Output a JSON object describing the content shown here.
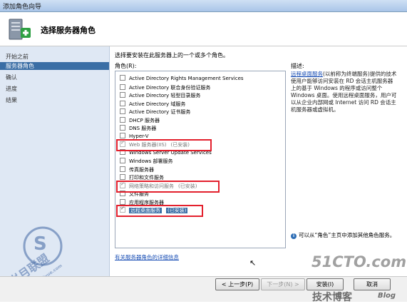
{
  "window": {
    "title": "添加角色向导"
  },
  "header": {
    "title": "选择服务器角色"
  },
  "sidebar": {
    "items": [
      {
        "label": "开始之前",
        "active": false
      },
      {
        "label": "服务器角色",
        "active": true
      },
      {
        "label": "确认",
        "active": false
      },
      {
        "label": "进度",
        "active": false
      },
      {
        "label": "结果",
        "active": false
      }
    ]
  },
  "main": {
    "instruction": "选择要安装在此服务器上的一个或多个角色。",
    "roles_label": "角色(R):",
    "roles": [
      {
        "label": "Active Directory Rights Management Services",
        "installed": false,
        "suffix": ""
      },
      {
        "label": "Active Directory 联合身份验证服务",
        "installed": false,
        "suffix": ""
      },
      {
        "label": "Active Directory 轻型目录服务",
        "installed": false,
        "suffix": ""
      },
      {
        "label": "Active Directory 域服务",
        "installed": false,
        "suffix": ""
      },
      {
        "label": "Active Directory 证书服务",
        "installed": false,
        "suffix": ""
      },
      {
        "label": "DHCP 服务器",
        "installed": false,
        "suffix": ""
      },
      {
        "label": "DNS 服务器",
        "installed": false,
        "suffix": ""
      },
      {
        "label": "Hyper-V",
        "installed": false,
        "suffix": ""
      },
      {
        "label": "Web 服务器(IIS)",
        "installed": true,
        "suffix": "(已安装)"
      },
      {
        "label": "Windows Server Update Services",
        "installed": false,
        "suffix": ""
      },
      {
        "label": "Windows 部署服务",
        "installed": false,
        "suffix": ""
      },
      {
        "label": "传真服务器",
        "installed": false,
        "suffix": ""
      },
      {
        "label": "打印和文件服务",
        "installed": false,
        "suffix": ""
      },
      {
        "label": "网络策略和访问服务",
        "installed": true,
        "suffix": "(已安装)"
      },
      {
        "label": "文件服务",
        "installed": false,
        "suffix": ""
      },
      {
        "label": "应用程序服务器",
        "installed": false,
        "suffix": ""
      },
      {
        "label": "远程桌面服务",
        "installed": true,
        "suffix": "(已安装)",
        "selected": true
      }
    ],
    "description_label": "描述:",
    "description_link": "远程桌面服务",
    "description_text": "(以前称为终端服务)提供的技术使用户能够访问安装在 RD 会话主机服务器上的基于 Windows 的程序或访问整个 Windows 桌面。使用远程桌面服务，用户可以从企业内部网或 Internet 访问 RD 会话主机服务器或虚拟机。",
    "info_note": "可以从“角色”主页中添加其他角色服务。",
    "more_info_link": "有关服务器角色的详细信息"
  },
  "buttons": {
    "prev": "< 上一步(P)",
    "next": "下一步(N) >",
    "install": "安装(I)",
    "cancel": "取消"
  },
  "watermarks": {
    "site": "51CTO.com",
    "tag": "技术博客",
    "blog": "Blog",
    "left_big": "S",
    "left_text": "岁月联盟",
    "left_url": "www.Syue.com"
  },
  "colors": {
    "highlight": "#3a6ea5",
    "red_annotation": "#e3202d",
    "sidebar_bg": "#dfe8f4"
  }
}
